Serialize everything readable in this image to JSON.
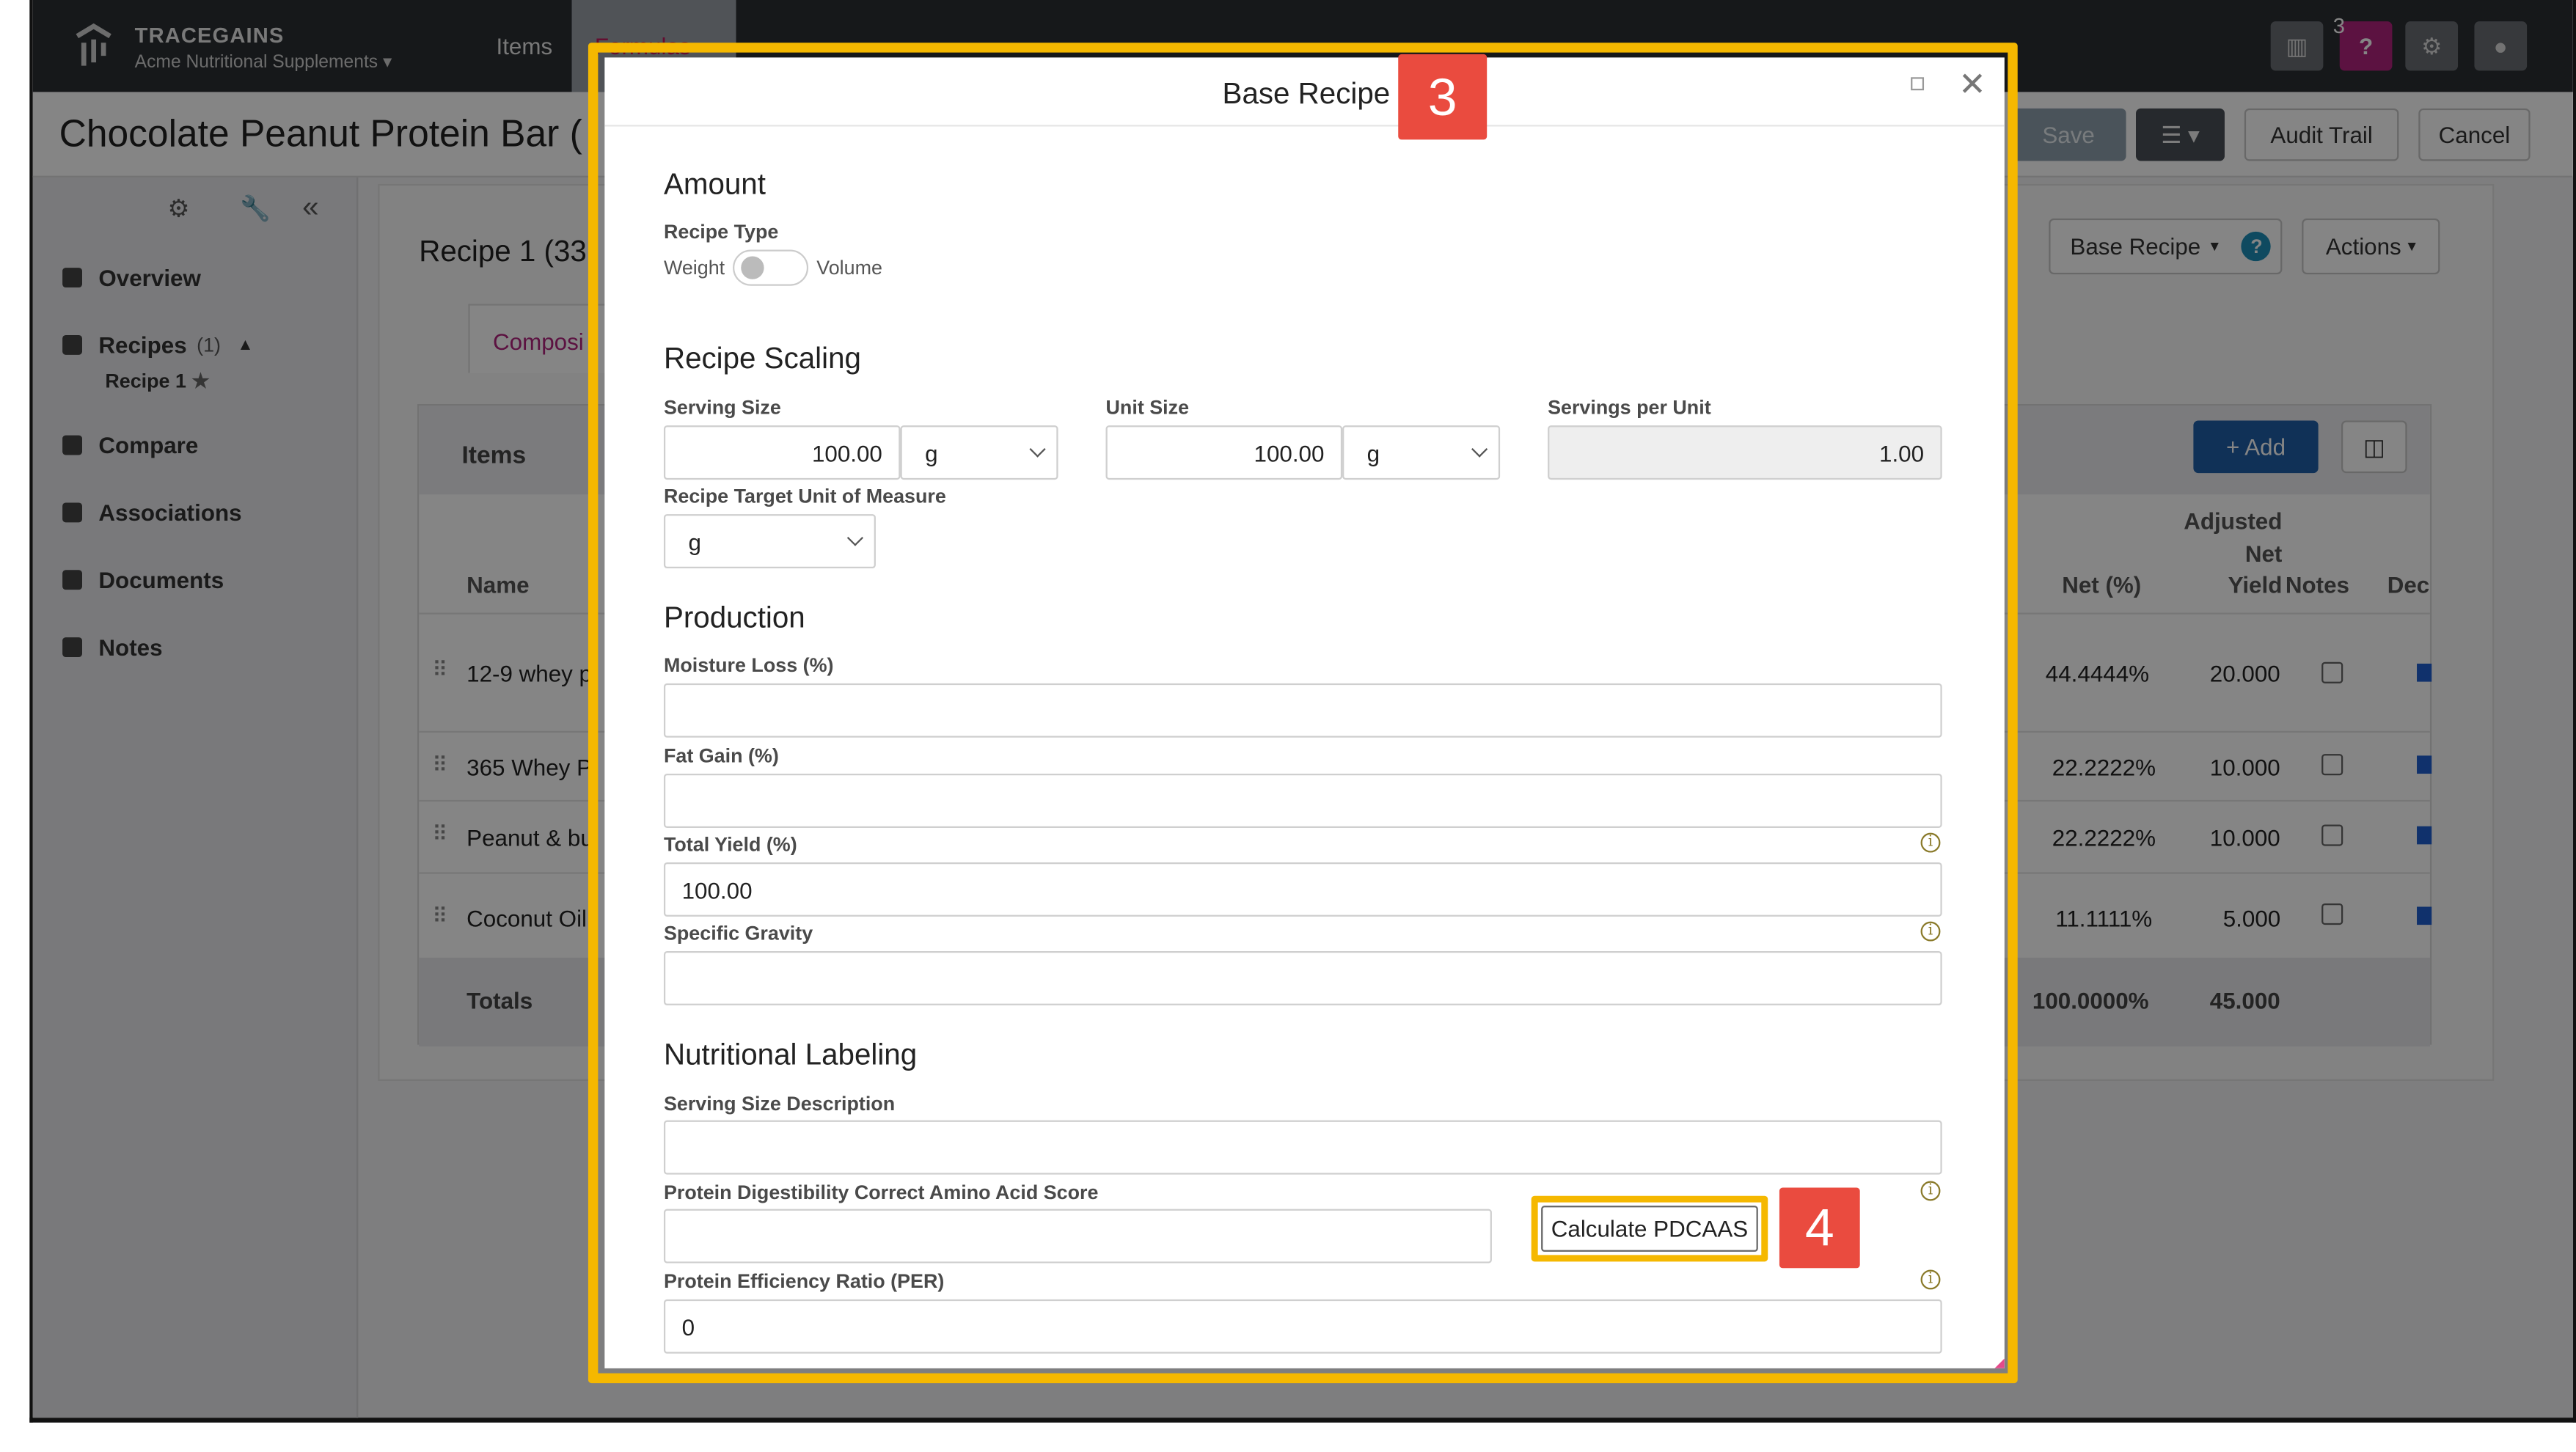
{
  "brand": {
    "name": "TRACEGAINS",
    "company": "Acme Nutritional Supplements"
  },
  "nav": {
    "tabs": [
      "Items",
      "Formulas"
    ]
  },
  "nav_badge": "3",
  "page": {
    "title": "Chocolate Peanut Protein Bar (",
    "save": "Save",
    "audit": "Audit Trail",
    "cancel": "Cancel"
  },
  "sidebar": {
    "items": [
      {
        "label": "Overview"
      },
      {
        "label": "Recipes",
        "count": "(1)"
      },
      {
        "label": "Recipe 1"
      },
      {
        "label": "Compare"
      },
      {
        "label": "Associations"
      },
      {
        "label": "Documents"
      },
      {
        "label": "Notes"
      }
    ]
  },
  "main": {
    "recipe_title": "Recipe 1 (33",
    "tab": "Composi",
    "base_recipe_btn": "Base Recipe",
    "actions_btn": "Actions",
    "items_label": "Items",
    "add_btn": "+ Add",
    "columns": {
      "name": "Name",
      "net": "Net (%)",
      "adjusted": "Adjusted",
      "adjusted2": "Net",
      "adjusted3": "Yield",
      "notes": "Notes",
      "dec": "Dec"
    },
    "rows": [
      {
        "name": "12-9 whey p",
        "net": "44.4444%",
        "yield": "20.000"
      },
      {
        "name": "365 Whey P",
        "net": "22.2222%",
        "yield": "10.000"
      },
      {
        "name": "Peanut & bu",
        "net": "22.2222%",
        "yield": "10.000"
      },
      {
        "name": "Coconut Oil",
        "net": "11.1111%",
        "yield": "5.000"
      }
    ],
    "totals": {
      "label": "Totals",
      "net": "100.0000%",
      "yield": "45.000"
    }
  },
  "modal": {
    "title": "Base Recipe",
    "amount": {
      "heading": "Amount",
      "recipe_type_label": "Recipe Type",
      "weight": "Weight",
      "volume": "Volume"
    },
    "scaling": {
      "heading": "Recipe Scaling",
      "serving_size_label": "Serving Size",
      "serving_size": "100.00",
      "serving_unit": "g",
      "unit_size_label": "Unit Size",
      "unit_size": "100.00",
      "unit_unit": "g",
      "servings_per_unit_label": "Servings per Unit",
      "servings_per_unit": "1.00",
      "target_uom_label": "Recipe Target Unit of Measure",
      "target_uom": "g"
    },
    "production": {
      "heading": "Production",
      "moisture_label": "Moisture Loss (%)",
      "moisture": "",
      "fat_label": "Fat Gain (%)",
      "fat": "",
      "yield_label": "Total Yield (%)",
      "yield": "100.00",
      "gravity_label": "Specific Gravity",
      "gravity": ""
    },
    "nutrition": {
      "heading": "Nutritional Labeling",
      "ssd_label": "Serving Size Description",
      "ssd": "",
      "pdcaas_label": "Protein Digestibility Correct Amino Acid Score",
      "pdcaas": "",
      "calc_btn": "Calculate PDCAAS",
      "per_label": "Protein Efficiency Ratio (PER)",
      "per": "0"
    }
  },
  "callouts": {
    "modal": "3",
    "button": "4"
  },
  "colors": {
    "accent": "#f5b800",
    "callout": "#ea4b3f",
    "nav": "#2b2e33",
    "primary": "#1f5fcf"
  }
}
